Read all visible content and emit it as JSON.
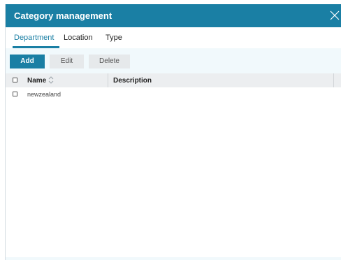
{
  "dialog": {
    "title": "Category management",
    "close_icon": "close-icon"
  },
  "tabs": [
    {
      "label": "Department",
      "active": true
    },
    {
      "label": "Location",
      "active": false
    },
    {
      "label": "Type",
      "active": false
    }
  ],
  "toolbar": {
    "add_label": "Add",
    "edit_label": "Edit",
    "delete_label": "Delete"
  },
  "grid": {
    "columns": [
      {
        "label": "Name",
        "sortable": true,
        "sort_icon": "sort-icon"
      },
      {
        "label": "Description",
        "sortable": false
      }
    ],
    "rows": [
      {
        "name": "newzealand",
        "description": ""
      }
    ]
  },
  "colors": {
    "accent": "#1a7fa4",
    "toolbar_bg": "#f1f9fc",
    "header_bg": "#eceef0"
  }
}
